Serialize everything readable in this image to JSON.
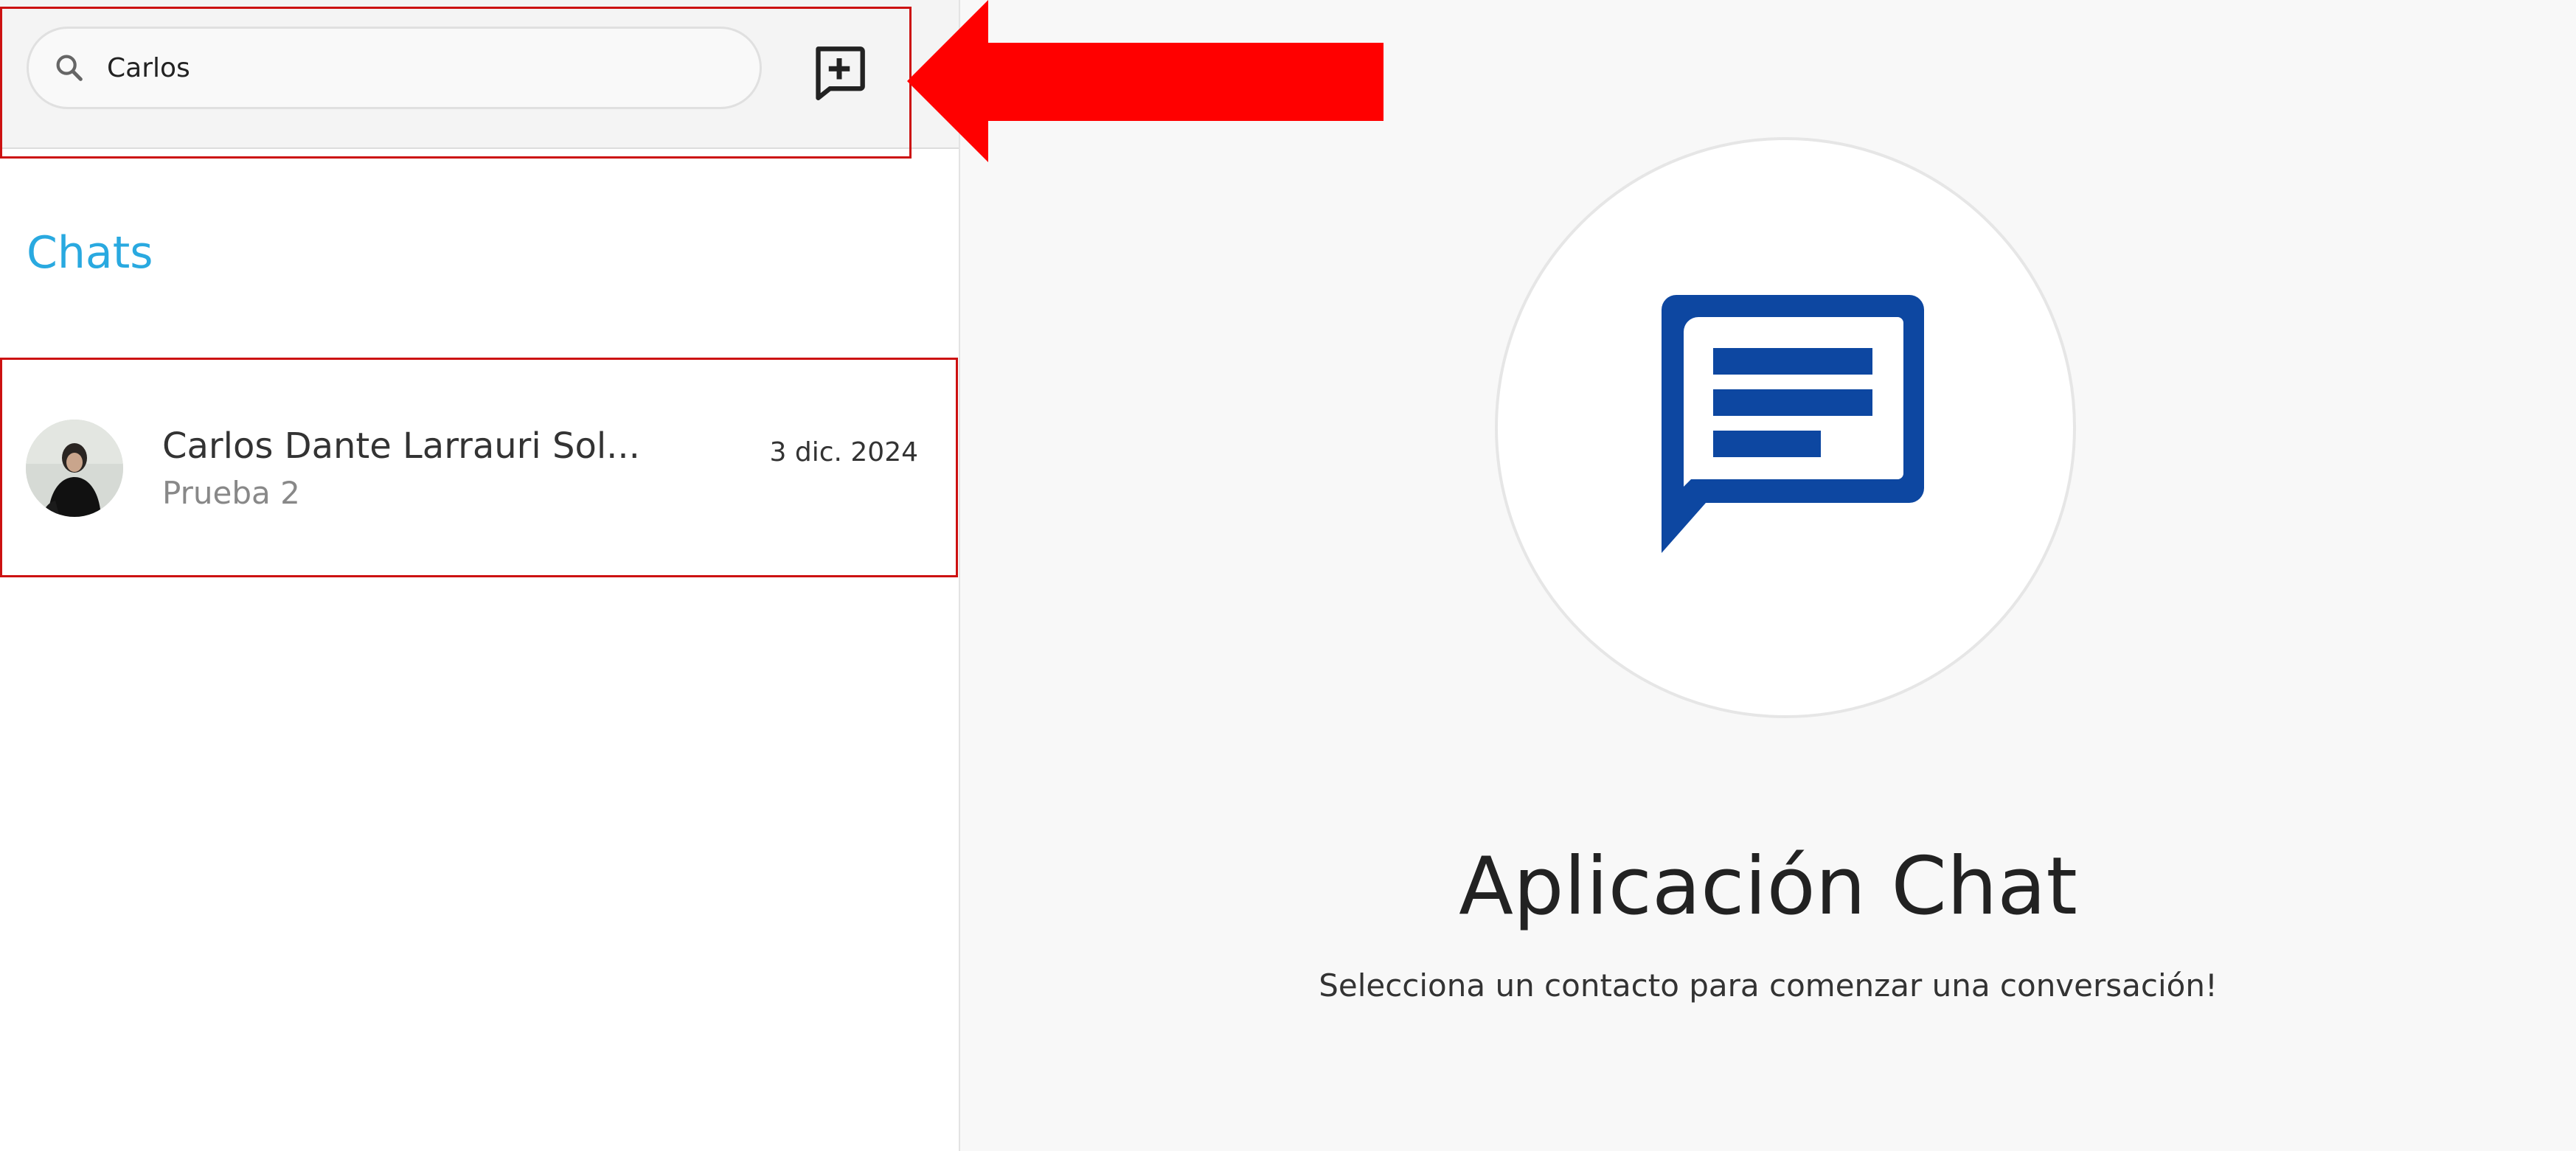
{
  "search": {
    "value": "Carlos",
    "icon": "search-icon"
  },
  "toolbar": {
    "new_chat_icon": "add-box-icon"
  },
  "sidebar": {
    "section_title": "Chats",
    "chats": [
      {
        "name": "Carlos Dante Larrauri Sol...",
        "last_message": "Prueba 2",
        "date": "3 dic. 2024",
        "avatar_icon": "avatar"
      }
    ]
  },
  "main": {
    "title": "Aplicación Chat",
    "subtitle": "Selecciona un contacto para comenzar una conversación!",
    "illustration_icon": "chat-bubble-icon"
  },
  "colors": {
    "accent": "#29a9e0",
    "brand_blue": "#0d47a1",
    "annotation_red": "#ff0000"
  }
}
